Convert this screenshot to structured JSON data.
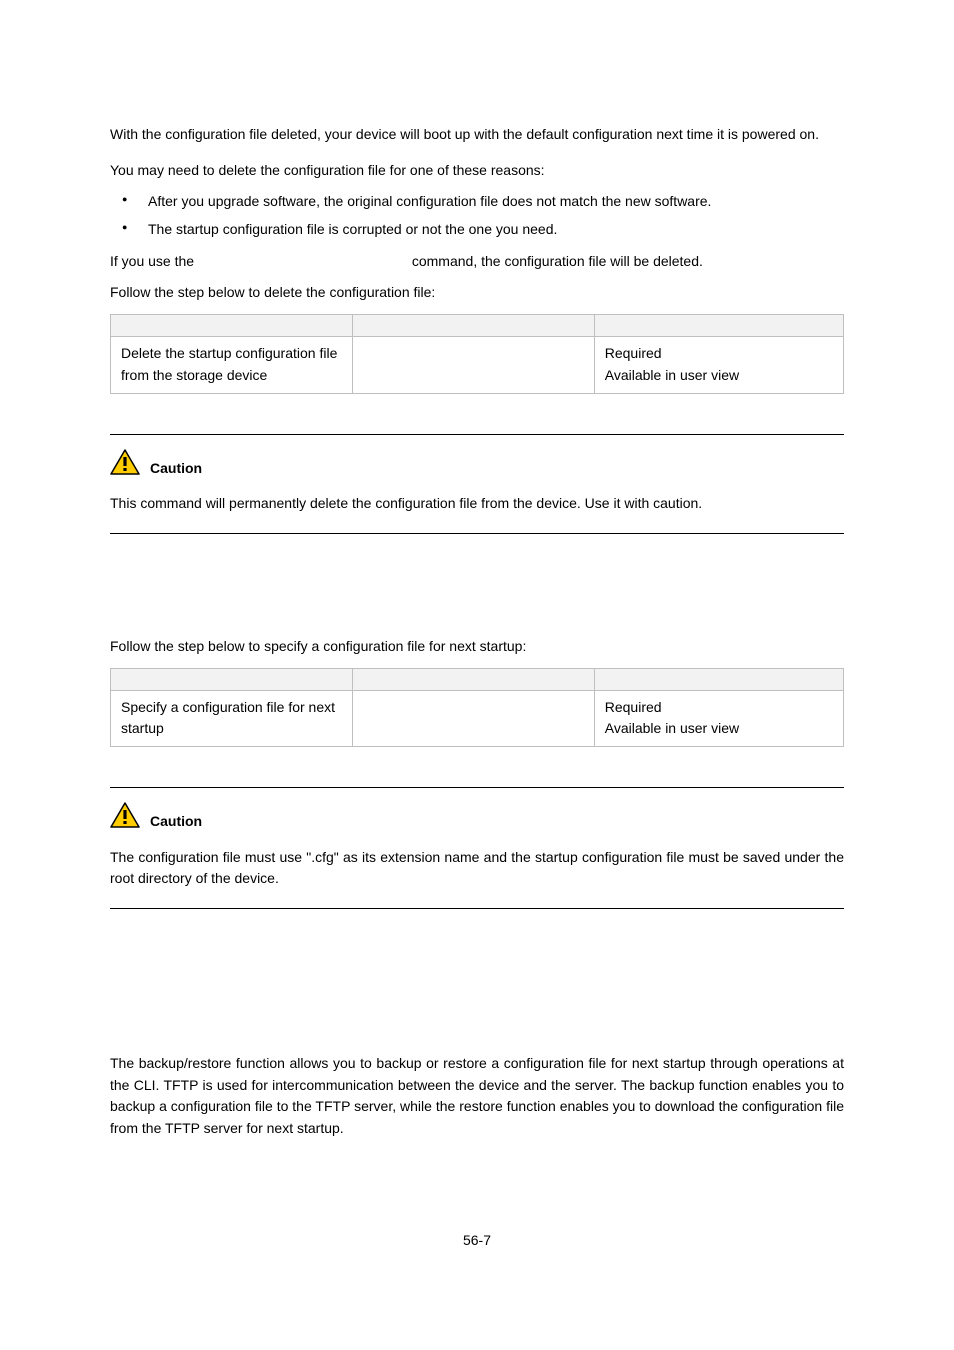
{
  "intro": {
    "p1": "With the configuration file deleted, your device will boot up with the default configuration next time it is powered on.",
    "p2": "You may need to delete the configuration file for one of these reasons:",
    "b1": "After you upgrade software, the original configuration file does not match the new software.",
    "b2": "The startup configuration file is corrupted or not the one you need.",
    "p3a": "If you use the ",
    "p3b": " command, the configuration file will be deleted.",
    "p4": "Follow the step below to delete the configuration file:"
  },
  "table1": {
    "h1": "",
    "h2": "",
    "h3": "",
    "r1c1": "Delete the startup configuration file from the storage device",
    "r1c2": "",
    "r1c3a": "Required",
    "r1c3b": "Available in user view"
  },
  "caution1": {
    "label": "Caution",
    "body": "This command will permanently delete the configuration file from the device. Use it with caution."
  },
  "spec": {
    "p1": "Follow the step below to specify a configuration file for next startup:"
  },
  "table2": {
    "h1": "",
    "h2": "",
    "h3": "",
    "r1c1": "Specify a configuration file for next startup",
    "r1c2": "",
    "r1c3a": "Required",
    "r1c3b": "Available in user view"
  },
  "caution2": {
    "label": "Caution",
    "body": "The configuration file must use \".cfg\" as its extension name and the startup configuration file must be saved under the root directory of the device."
  },
  "backup": {
    "p1": "The backup/restore function allows you to backup or restore a configuration file for next startup through operations at the CLI. TFTP is used for intercommunication between the device and the server. The backup function enables you to backup a configuration file to the TFTP server, while the restore function enables you to download the configuration file from the TFTP server for next startup."
  },
  "footer": "56-7"
}
